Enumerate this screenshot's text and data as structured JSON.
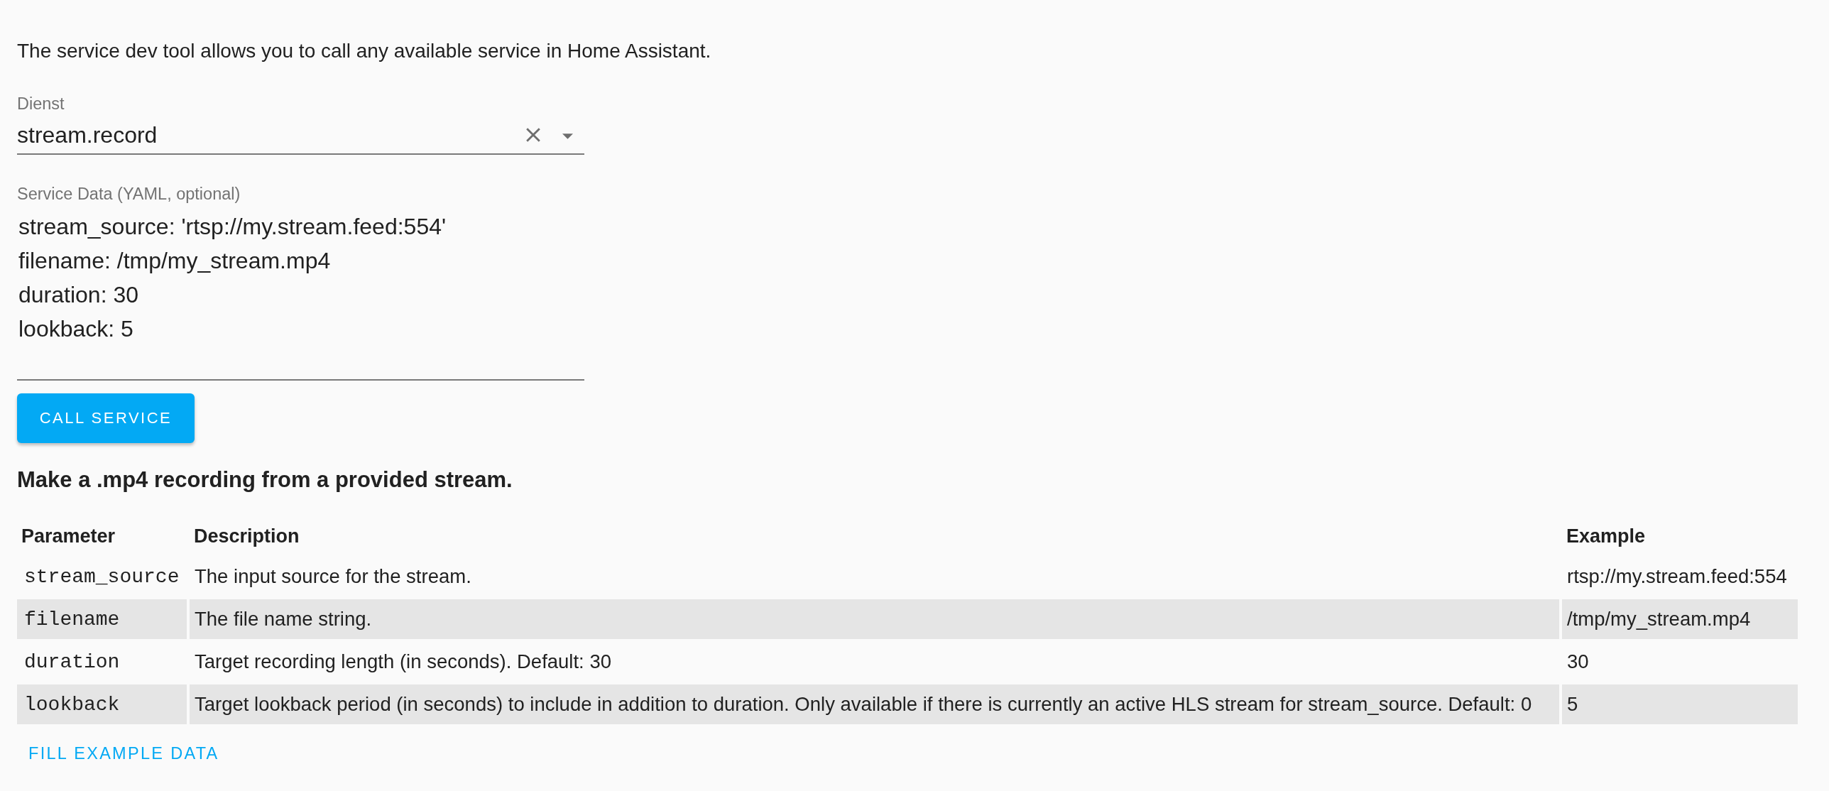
{
  "intro": "The service dev tool allows you to call any available service in Home Assistant.",
  "service_field": {
    "label": "Dienst",
    "value": "stream.record"
  },
  "service_data": {
    "label": "Service Data (YAML, optional)",
    "lines": [
      "stream_source: 'rtsp://my.stream.feed:554'",
      "filename: /tmp/my_stream.mp4",
      "duration: 30",
      "lookback: 5"
    ]
  },
  "call_button": "CALL SERVICE",
  "service_description": "Make a .mp4 recording from a provided stream.",
  "table": {
    "columns": [
      "Parameter",
      "Description",
      "Example"
    ],
    "rows": [
      {
        "parameter": "stream_source",
        "description": "The input source for the stream.",
        "example": "rtsp://my.stream.feed:554"
      },
      {
        "parameter": "filename",
        "description": "The file name string.",
        "example": "/tmp/my_stream.mp4"
      },
      {
        "parameter": "duration",
        "description": "Target recording length (in seconds). Default: 30",
        "example": "30"
      },
      {
        "parameter": "lookback",
        "description": "Target lookback period (in seconds) to include in addition to duration. Only available if there is currently an active HLS stream for stream_source. Default: 0",
        "example": "5"
      }
    ]
  },
  "fill_button": "FILL EXAMPLE DATA"
}
